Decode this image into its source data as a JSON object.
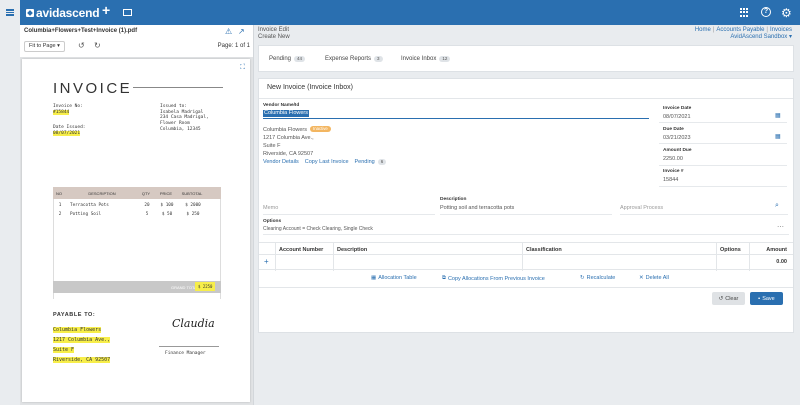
{
  "app": {
    "brand": "avidascend"
  },
  "pdf": {
    "filename": "Columbia+Flowers+Test+Invoice (1).pdf",
    "fit_label": "Fit to Page",
    "page_info": "Page: 1 of 1",
    "invoice": {
      "title": "INVOICE",
      "invoice_no_label": "Invoice No:",
      "invoice_no": "#15844",
      "date_label": "Date Issued:",
      "date": "08/07/2021",
      "issued_to_label": "Issued to:",
      "issued_to": [
        "Isabela Madrigal",
        "234 Casa Madrigal,",
        "Flower Room",
        "Columbia, 12345"
      ],
      "columns": [
        "NO",
        "DESCRIPTION",
        "QTY",
        "PRICE",
        "SUBTOTAL"
      ],
      "rows": [
        {
          "no": "1",
          "desc": "Terracotta Pots",
          "qty": "20",
          "price": "$ 100",
          "subtotal": "$ 2000"
        },
        {
          "no": "2",
          "desc": "Potting Soil",
          "qty": "5",
          "price": "$ 50",
          "subtotal": "$ 250"
        }
      ],
      "grand_total_label": "GRAND TOTAL",
      "grand_total": "$ 2250",
      "payable_label": "PAYABLE TO:",
      "payable_lines": [
        "Columbia Flowers",
        "1217 Columbia Ave.,",
        "Suite F",
        "Riverside, CA 92507"
      ],
      "signature": "Claudia",
      "signer_role": "Finance Manager"
    }
  },
  "header": {
    "crumb_title": "Invoice Edit",
    "crumb_sub": "Create New",
    "breadcrumb": [
      "Home",
      "Accounts Payable",
      "Invoices"
    ],
    "company": "AvidAscend Sandbox"
  },
  "tabs": [
    {
      "label": "Pending",
      "count": "44"
    },
    {
      "label": "Expense Reports",
      "count": "3"
    },
    {
      "label": "Invoice Inbox",
      "count": "12"
    }
  ],
  "form": {
    "title": "New Invoice (Invoice Inbox)",
    "vendor_label": "Vendor Name/Id",
    "vendor_value": "Columbia Flowers",
    "vendor_name": "Columbia Flowers",
    "vendor_status": "Inactive",
    "address": [
      "1217 Columbia Ave.,",
      "Suite F",
      "Riverside, CA 92507"
    ],
    "links": [
      "Vendor Details",
      "Copy Last Invoice",
      "Pending"
    ],
    "pending_count": "6",
    "invoice_date_label": "Invoice Date",
    "invoice_date": "08/07/2021",
    "due_date_label": "Due Date",
    "due_date": "03/21/2023",
    "amount_due_label": "Amount Due",
    "amount_due": "2250.00",
    "invoice_no_label": "Invoice #",
    "invoice_no": "15844",
    "memo_placeholder": "Memo",
    "description_label": "Description",
    "description": "Potting soil and terracotta pots",
    "approval_placeholder": "Approval Process",
    "options_label": "Options",
    "options_value": "Clearing Account = Check Clearing, Single Check"
  },
  "grid": {
    "columns": [
      "Account Number",
      "Description",
      "Classification",
      "Options",
      "Amount"
    ],
    "amount_total": "0.00"
  },
  "actions": [
    "Allocation Table",
    "Copy Allocations From Previous Invoice",
    "Recalculate",
    "Delete All"
  ],
  "buttons": {
    "clear": "Clear",
    "save": "Save"
  },
  "colors": {
    "brand": "#2a6fb0",
    "highlight": "#f7ee4a",
    "inactive_badge": "#f3b661"
  }
}
